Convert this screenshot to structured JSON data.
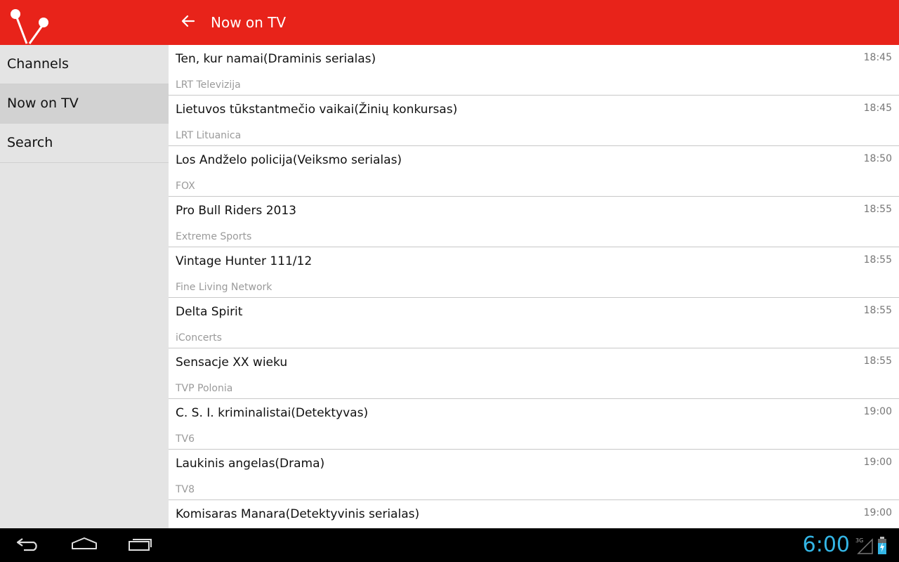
{
  "appbar": {
    "title": "Now on TV",
    "accent_color": "#e8231a",
    "logo_icon": "tv-antenna-logo-icon",
    "back_icon": "arrow-back-icon"
  },
  "sidebar": {
    "items": [
      {
        "label": "Channels",
        "active": false
      },
      {
        "label": "Now on TV",
        "active": true
      },
      {
        "label": "Search",
        "active": false
      }
    ]
  },
  "programs": [
    {
      "title": "Ten, kur namai(Draminis serialas)",
      "channel": "LRT Televizija",
      "time": "18:45"
    },
    {
      "title": "Lietuvos tūkstantmečio vaikai(Žinių konkursas)",
      "channel": "LRT Lituanica",
      "time": "18:45"
    },
    {
      "title": "Los Andželo policija(Veiksmo serialas)",
      "channel": "FOX",
      "time": "18:50"
    },
    {
      "title": "Pro Bull Riders 2013",
      "channel": "Extreme Sports",
      "time": "18:55"
    },
    {
      "title": "Vintage Hunter 111/12",
      "channel": "Fine Living Network",
      "time": "18:55"
    },
    {
      "title": "Delta Spirit",
      "channel": "iConcerts",
      "time": "18:55"
    },
    {
      "title": "Sensacje XX wieku",
      "channel": "TVP Polonia",
      "time": "18:55"
    },
    {
      "title": "C. S. I. kriminalistai(Detektyvas)",
      "channel": "TV6",
      "time": "19:00"
    },
    {
      "title": "Laukinis angelas(Drama)",
      "channel": "TV8",
      "time": "19:00"
    },
    {
      "title": "Komisaras Manara(Detektyvinis serialas)",
      "channel": "",
      "time": "19:00"
    }
  ],
  "system_bar": {
    "clock": "6:00",
    "clock_color": "#33b5e5",
    "network_type": "3G",
    "icons": [
      "back-icon",
      "home-icon",
      "recent-apps-icon",
      "signal-icon",
      "battery-charging-icon"
    ]
  }
}
